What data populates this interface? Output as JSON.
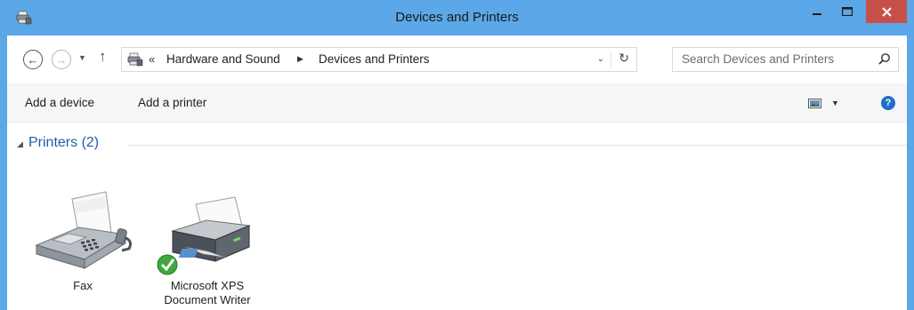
{
  "window": {
    "title": "Devices and Printers",
    "accent_color": "#5ba7e7",
    "close_color": "#c7504b",
    "title_icon": "devices-printers-icon"
  },
  "nav": {
    "back_icon": "back-arrow-icon",
    "forward_icon": "forward-arrow-icon",
    "recent_icon": "chevron-down-icon",
    "up_icon": "up-arrow-icon",
    "address": {
      "overflow": "«",
      "crumbs": [
        "Hardware and Sound",
        "Devices and Printers"
      ]
    },
    "search": {
      "placeholder": "Search Devices and Printers"
    }
  },
  "toolbar": {
    "add_device": "Add a device",
    "add_printer": "Add a printer"
  },
  "group": {
    "label": "Printers (2)"
  },
  "devices": [
    {
      "label": "Fax",
      "icon": "fax-icon"
    },
    {
      "label": "Microsoft XPS\nDocument Writer",
      "icon": "printer-default-icon",
      "label_lines": [
        "Microsoft XPS",
        "Document Writer"
      ]
    }
  ]
}
